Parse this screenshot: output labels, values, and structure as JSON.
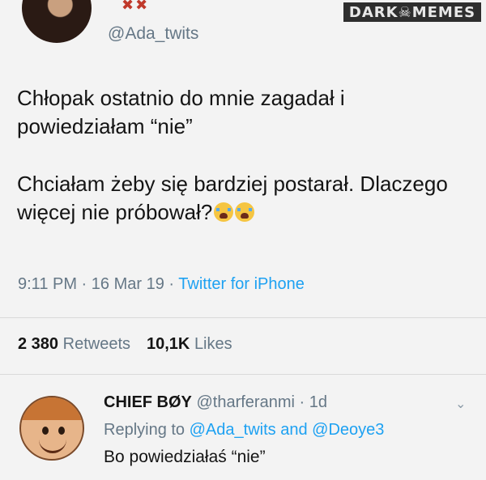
{
  "tweet": {
    "handle": "@Ada_twits",
    "line1": "Chłopak ostatnio do mnie zagadał i powiedziałam “nie”",
    "line2": "Chciałam żeby się bardziej postarał. Dlaczego więcej nie próbował?",
    "emoji": "loudly-crying-face",
    "time": "9:11 PM",
    "sep": " · ",
    "date": "16 Mar 19",
    "source": "Twitter for iPhone"
  },
  "stats": {
    "retweets_count": "2 380",
    "retweets_label": "Retweets",
    "likes_count": "10,1K",
    "likes_label": "Likes"
  },
  "watermark": "DARK☠MEMES",
  "reply": {
    "name": "CHIEF BØY",
    "handle": "@tharferanmi",
    "age": "1d",
    "replying_prefix": "Replying to",
    "mention1": "@Ada_twits",
    "and": "and",
    "mention2": "@Deoye3",
    "text": "Bo powiedziałaś “nie”"
  },
  "colors": {
    "accent": "#1da1f2",
    "muted": "#657786",
    "text": "#141414"
  }
}
